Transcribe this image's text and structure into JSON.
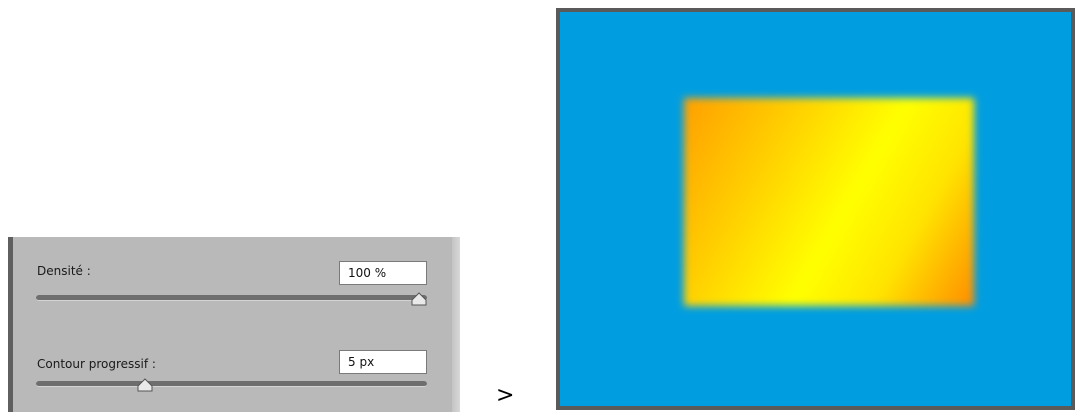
{
  "panel": {
    "density": {
      "label": "Densité :",
      "value": "100 %",
      "slider_fraction": 1.0
    },
    "feather": {
      "label": "Contour progressif :",
      "value": "5 px",
      "slider_fraction": 0.27
    }
  },
  "arrow_text": ">",
  "preview": {
    "background_color": "#009ee0",
    "gradient_colors": [
      "#ff9f00",
      "#ffff00",
      "#ff8c00"
    ]
  }
}
